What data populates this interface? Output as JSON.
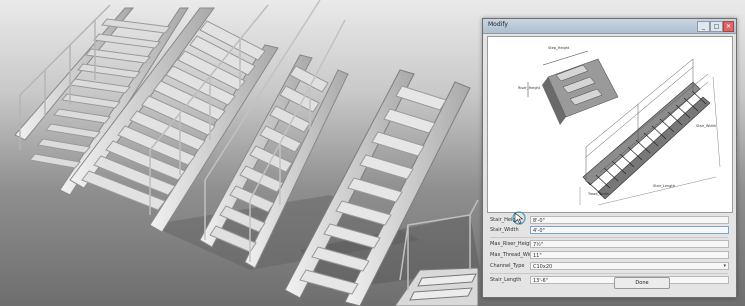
{
  "dialog": {
    "title": "Modify",
    "close_glyph": "✕",
    "maximize_glyph": "□",
    "minimize_glyph": "_",
    "ok_label": "Done"
  },
  "preview": {
    "dimension_labels": [
      "Riser_Height",
      "Step_Height",
      "Tread_Width",
      "Stair_Length",
      "Stair_Width"
    ]
  },
  "params": [
    {
      "label": "Stair_Height",
      "value": "8'-0\""
    },
    {
      "label": "Stair_Width",
      "value": "4'-0\""
    },
    {
      "label": "Max_Riser_Height",
      "value": "7½\""
    },
    {
      "label": "Max_Thread_Width",
      "value": "11\""
    },
    {
      "label": "Channel_Type",
      "value": "C10x20",
      "type": "dropdown"
    },
    {
      "label": "Stair_Length",
      "value": "13'-6\""
    }
  ],
  "icons": {
    "cursor": "arrow-cursor-icon",
    "dropdown": "chevron-down-icon"
  },
  "colors": {
    "steel": "#d8d8d8",
    "steel_shadow": "#7a7a7a",
    "titlebar": "#b9c8d8"
  }
}
